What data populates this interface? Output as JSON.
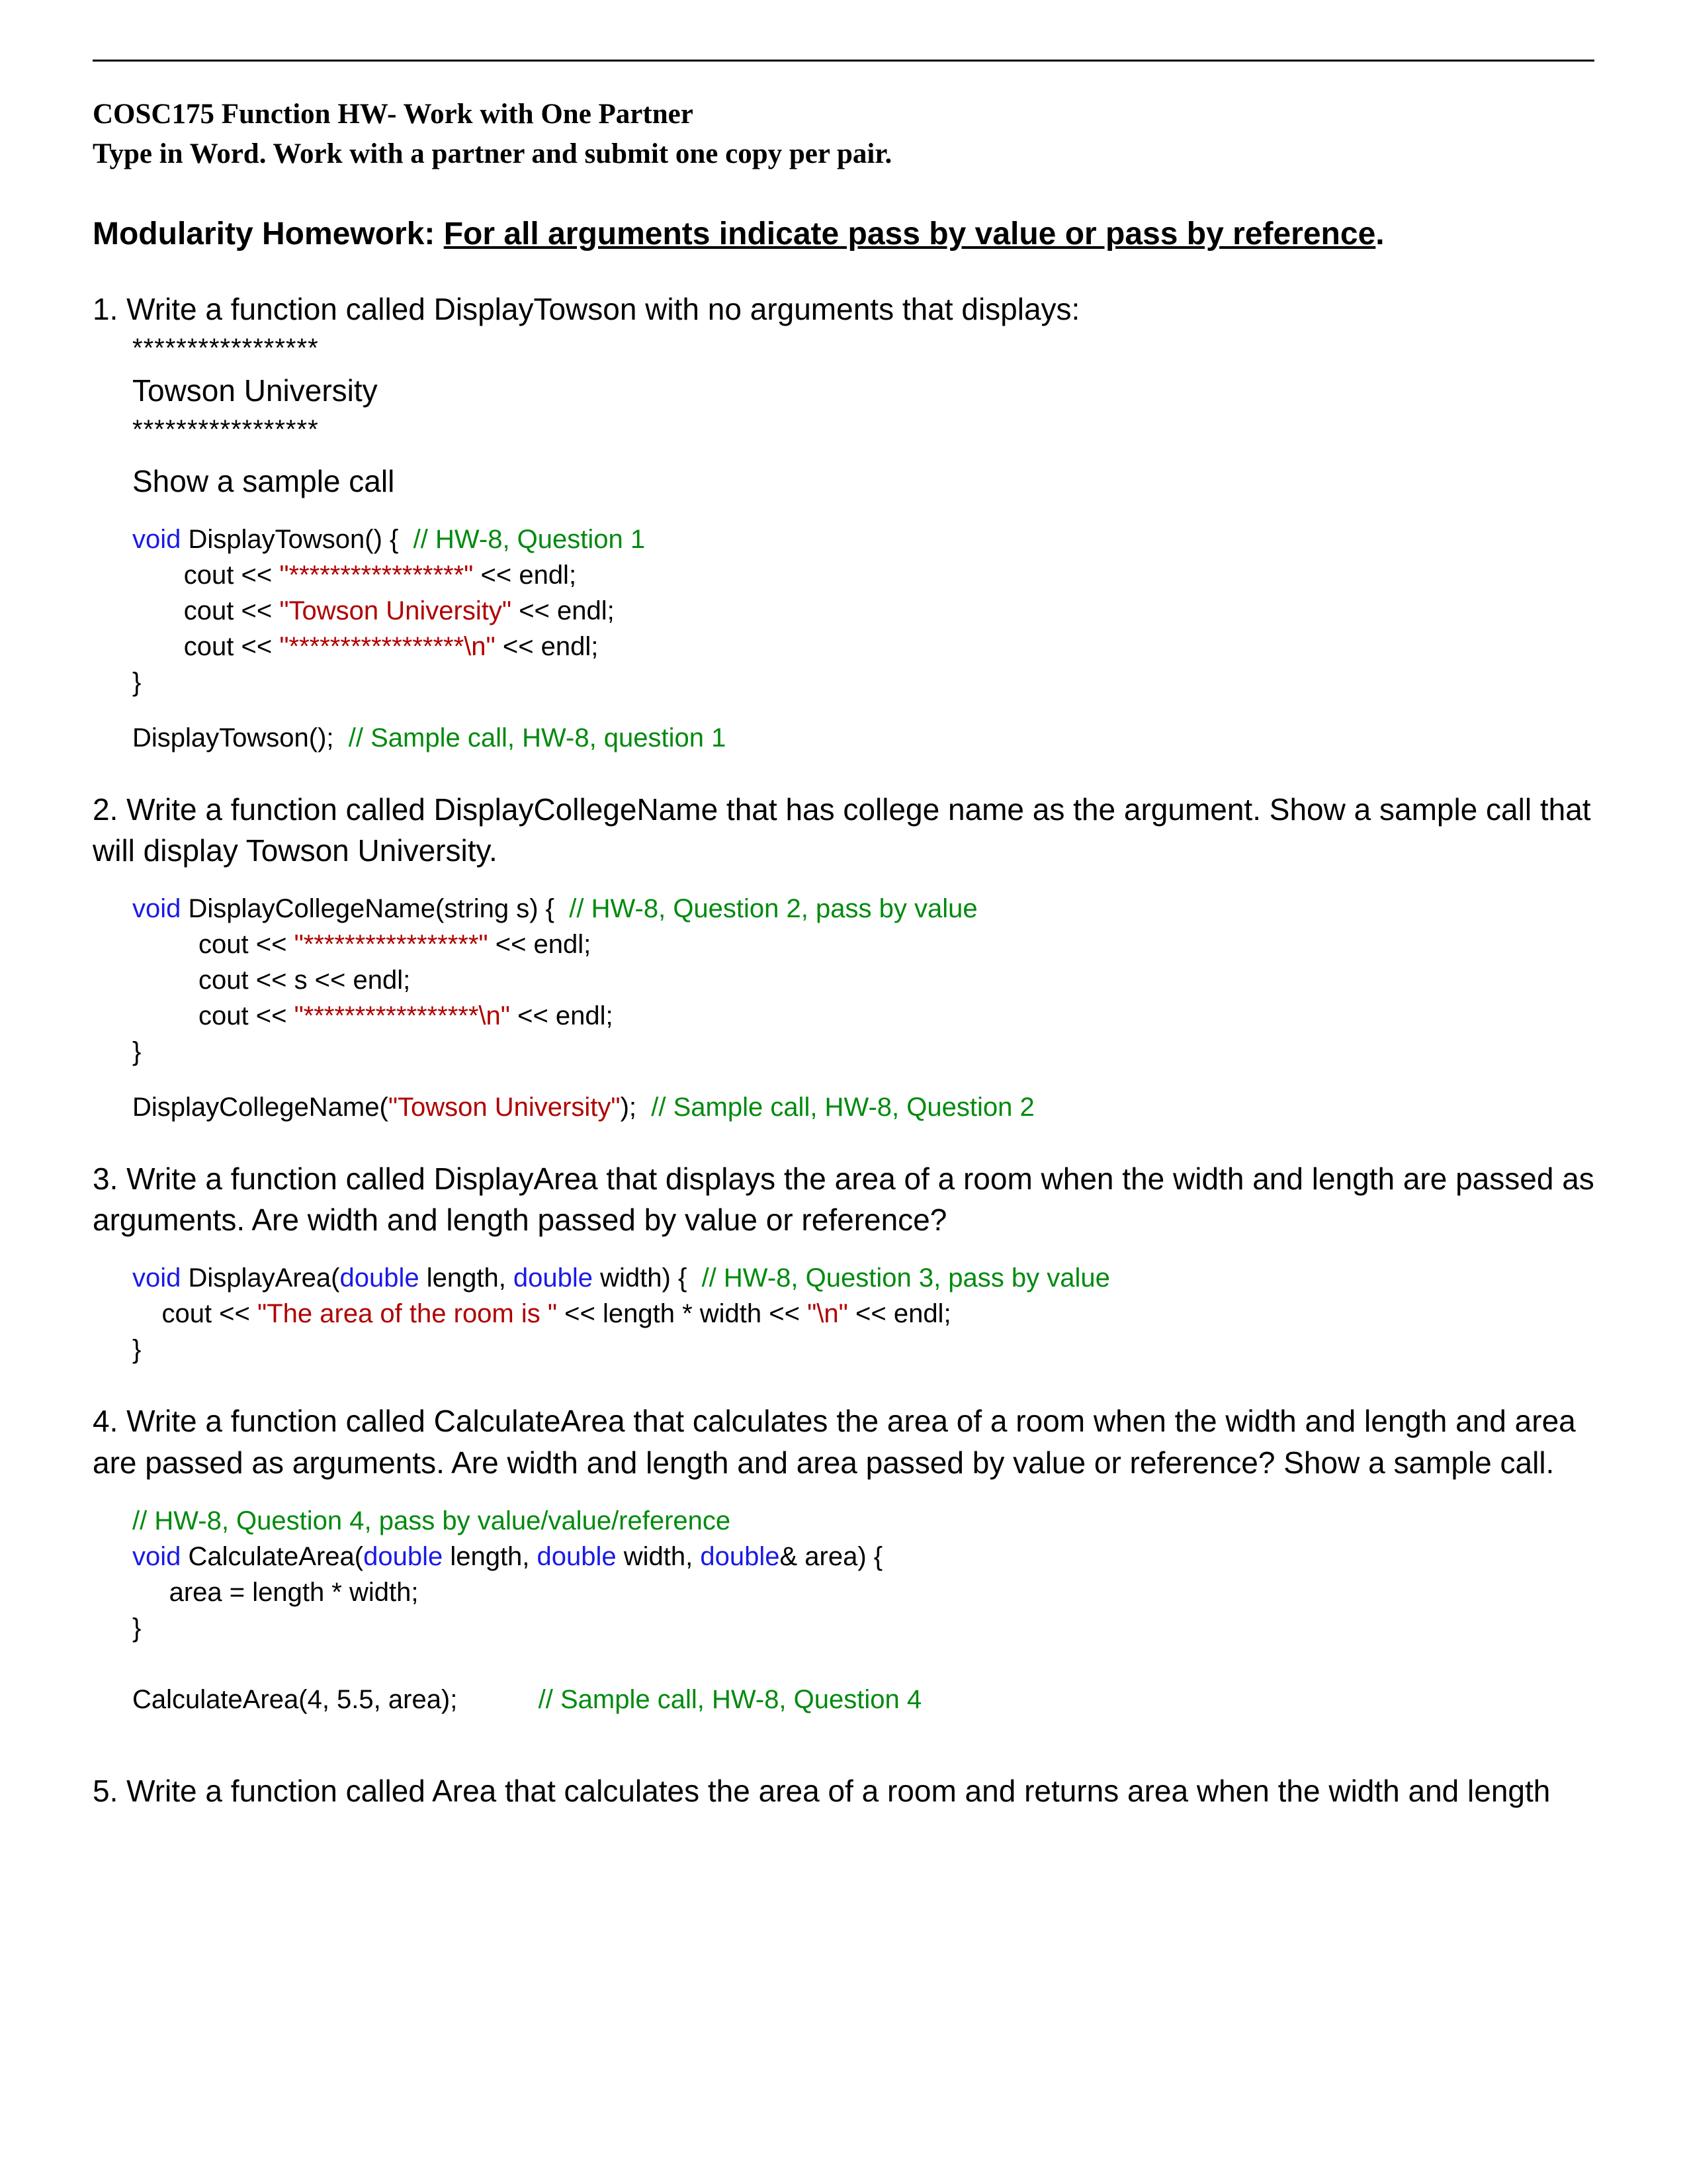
{
  "header": {
    "line1": "COSC175 Function HW- Work with One Partner",
    "line2": "Type in Word. Work with a partner and submit one copy per pair."
  },
  "heading": {
    "prefix": "Modularity Homework: ",
    "underlined": "For all arguments indicate pass by value or pass by reference"
  },
  "q1": {
    "prompt": "1.      Write a function called DisplayTowson with no arguments that displays:",
    "stars1": "*****************",
    "towson": "Towson University",
    "stars2": " *****************",
    "show": "Show a sample call",
    "code": {
      "sig_kw": "void",
      "sig_rest": " DisplayTowson() {  ",
      "sig_cm": "// HW-8, Question 1",
      "l1a": "       cout << ",
      "l1s": "\"*****************\"",
      "l1b": " << endl;",
      "l2a": "       cout << ",
      "l2s": "\"Towson University\"",
      "l2b": " << endl;",
      "l3a": "       cout << ",
      "l3s": "\"*****************\\n\"",
      "l3b": " << endl;",
      "close": "}",
      "call": "DisplayTowson();  ",
      "call_cm": "// Sample call, HW-8, question 1"
    }
  },
  "q2": {
    "prompt": "2.  Write a function called DisplayCollegeName that has college name as the argument.  Show a sample call that",
    "prompt2": "     will display Towson University.",
    "code": {
      "sig_kw": "void",
      "sig_rest": " DisplayCollegeName(string s) {  ",
      "sig_cm": "// HW-8, Question 2, pass by value",
      "l1a": "         cout << ",
      "l1s": "\"*****************\"",
      "l1b": " << endl;",
      "l2": "         cout << s << endl;",
      "l3a": "         cout << ",
      "l3s": "\"*****************\\n\"",
      "l3b": " << endl;",
      "close": "}",
      "call_a": "DisplayCollegeName(",
      "call_s": "\"Towson University\"",
      "call_b": ");  ",
      "call_cm": "// Sample call, HW-8, Question 2"
    }
  },
  "q3": {
    "prompt": "3.  Write a function called DisplayArea that displays the area of a room when the width and length are passed as",
    "prompt2": "     arguments. Are width and length passed by value or reference?",
    "code": {
      "sig_kw": "void",
      "sig_a": " DisplayArea(",
      "sig_d1": "double",
      "sig_b": " length, ",
      "sig_d2": "double",
      "sig_c": " width) {  ",
      "sig_cm": "// HW-8, Question 3, pass by value",
      "l1a": "    cout << ",
      "l1s": "\"The area of the room is \"",
      "l1b": " << length * width << ",
      "l1n": "\"\\n\"",
      "l1c": " << endl;",
      "close": "}"
    }
  },
  "q4": {
    "prompt": "4.  Write a function called CalculateArea that calculates the area of a room when the width and length and area",
    "prompt2": "     are passed as arguments. Are width and length and area passed by value or reference? Show a sample call.",
    "code": {
      "cm1": "// HW-8, Question 4, pass by value/value/reference",
      "sig_kw": "void",
      "sig_a": " CalculateArea(",
      "sig_d1": "double",
      "sig_b": " length, ",
      "sig_d2": "double",
      "sig_c": " width, ",
      "sig_d3": "double",
      "sig_d": "& area) {",
      "body": "     area = length * width;",
      "close": "}",
      "call": "CalculateArea(4, 5.5, area);           ",
      "call_cm": "// Sample call, HW-8, Question 4"
    }
  },
  "q5": {
    "prompt": "5.  Write a function called Area that calculates the area of a room and returns area when the width and length"
  }
}
